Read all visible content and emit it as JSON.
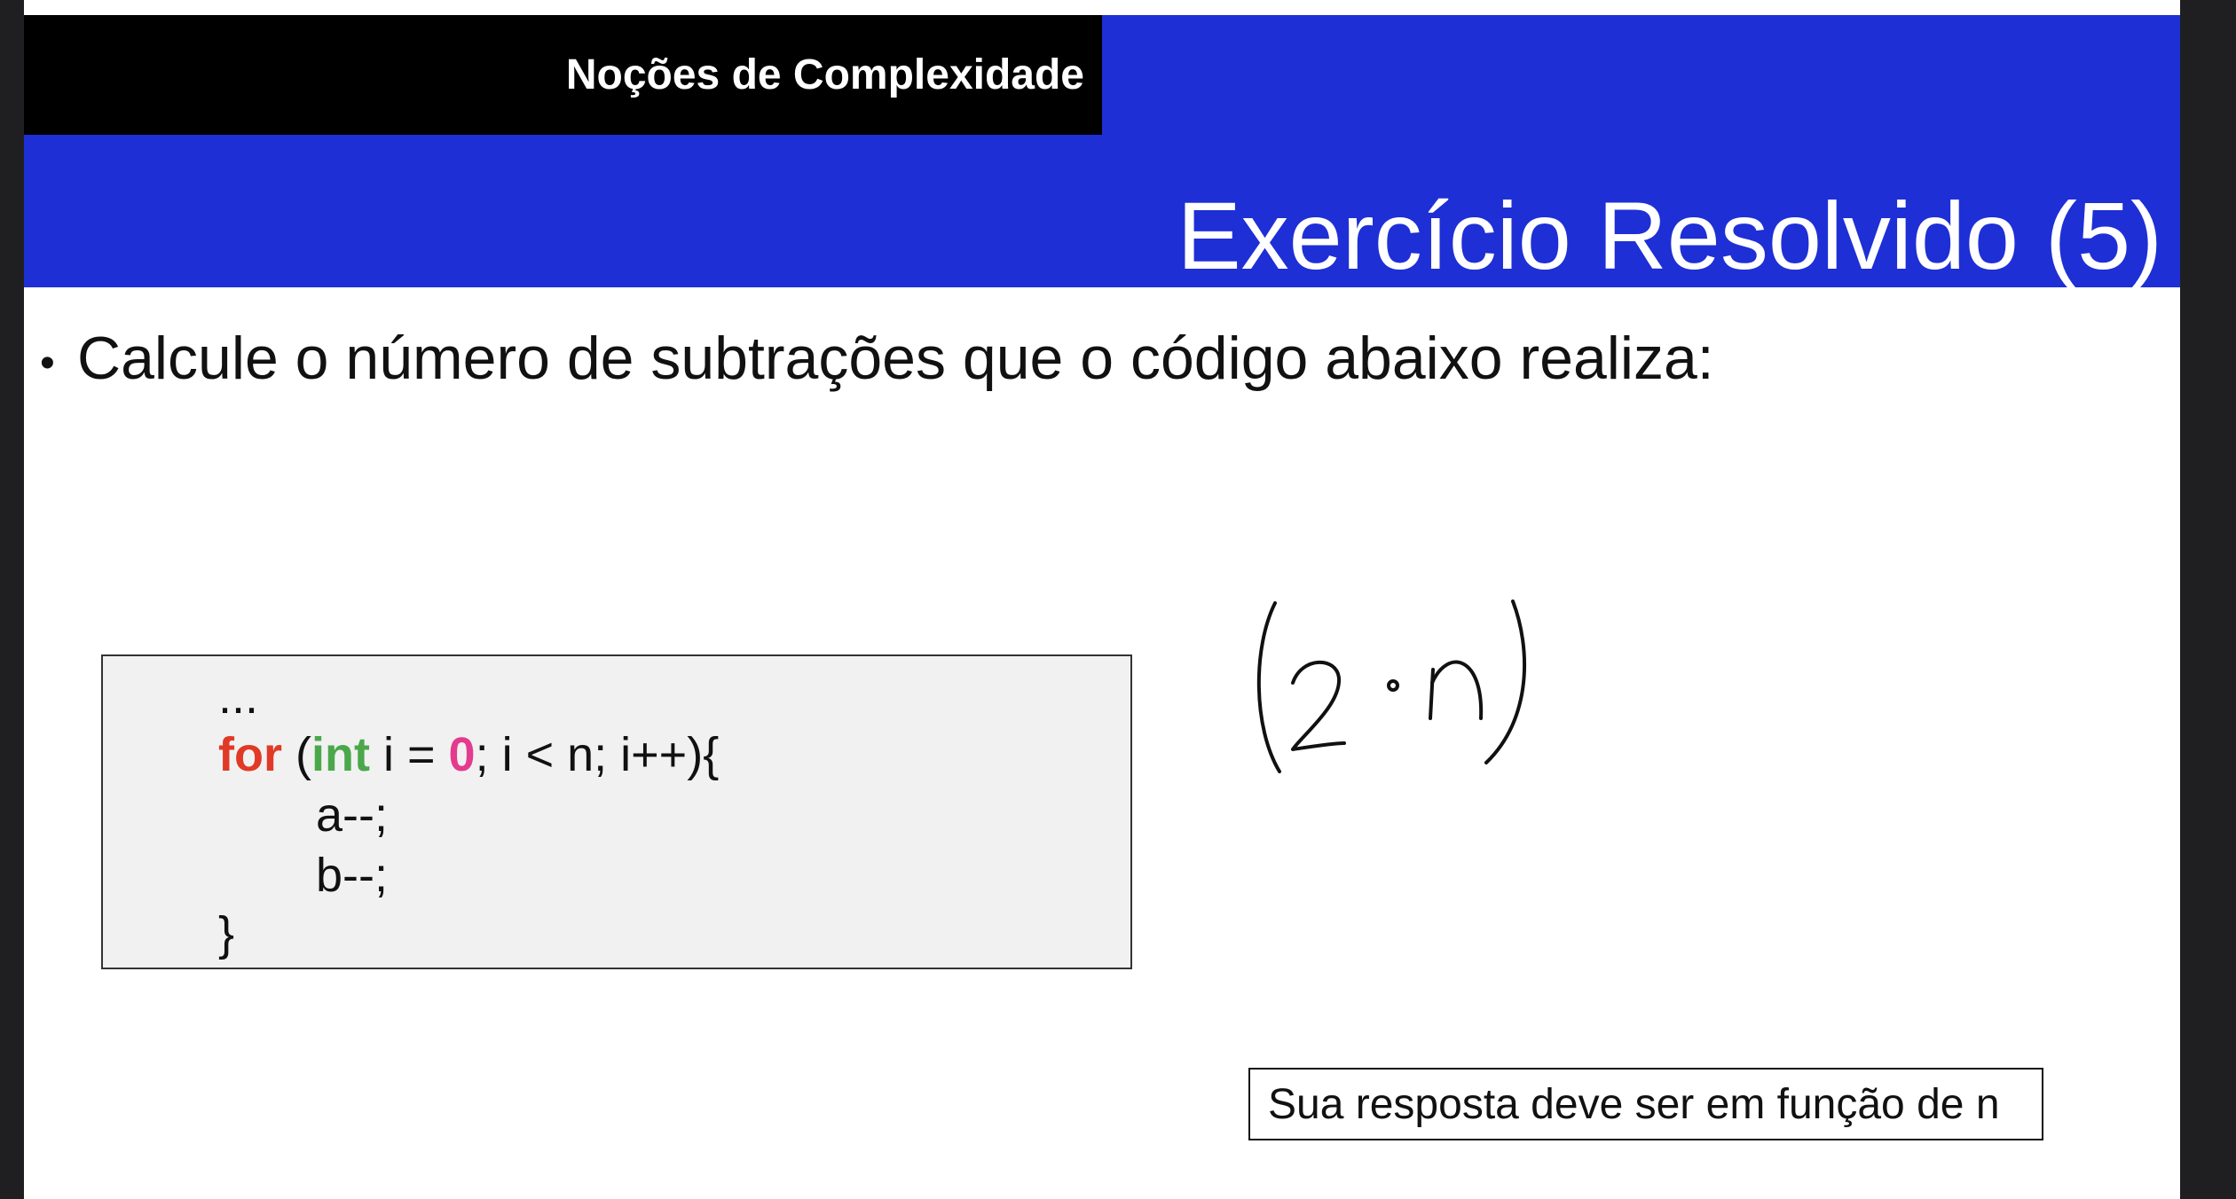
{
  "slide": {
    "section_title": "Noções de Complexidade",
    "title": "Exercício Resolvido (5)",
    "bullet_symbol": "•",
    "bullet_text": "Calcule o número de subtrações que o código abaixo realiza:"
  },
  "code": {
    "ellipsis": "...",
    "for_keyword": "for",
    "paren_open": " (",
    "int_keyword": "int",
    "init_part": " i = ",
    "zero": "0",
    "rest": "; i < n; i++){",
    "line_a": "a--;",
    "line_b": "b--;",
    "close_brace": "}"
  },
  "handwritten_answer": "(2 · n)",
  "note": "Sua resposta deve ser em função de n",
  "colors": {
    "header_blue": "#1e2fd6",
    "section_bar": "#000000",
    "keyword_for": "#e03a26",
    "keyword_int": "#4aa84a",
    "literal_zero": "#e43b8e",
    "code_background": "#f1f1f1"
  }
}
